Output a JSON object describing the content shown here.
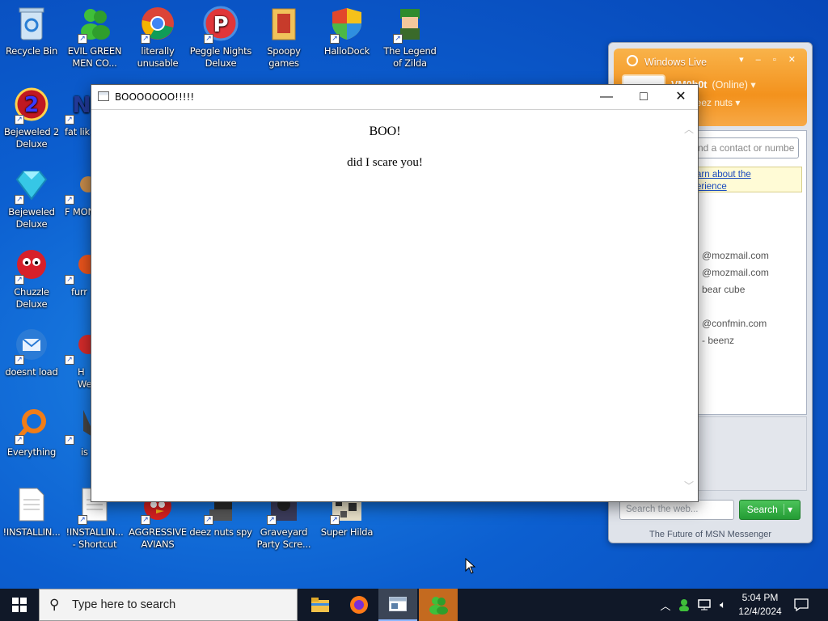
{
  "desktop": {
    "icons": [
      {
        "label": "Recycle Bin",
        "icon": "recycle-bin-icon"
      },
      {
        "label": "EVIL GREEN MEN CO...",
        "icon": "green-men-icon"
      },
      {
        "label": "literally unusable",
        "icon": "chrome-icon"
      },
      {
        "label": "Peggle Nights Deluxe",
        "icon": "peggle-icon"
      },
      {
        "label": "Spoopy games",
        "icon": "folder-icon"
      },
      {
        "label": "HalloDock",
        "icon": "shield-icon"
      },
      {
        "label": "The Legend of Zilda",
        "icon": "zilda-icon"
      },
      {
        "label": "Bejeweled 2 Deluxe",
        "icon": "bejeweled2-icon"
      },
      {
        "label": "fat lik",
        "icon": "fat-lik-icon"
      },
      {
        "label": "Bejeweled Deluxe",
        "icon": "diamond-icon"
      },
      {
        "label": "F MON",
        "icon": "mon-icon"
      },
      {
        "label": "Chuzzle Deluxe",
        "icon": "chuzzle-icon"
      },
      {
        "label": "furr",
        "icon": "furr-icon"
      },
      {
        "label": "doesnt load",
        "icon": "thunderbird-icon"
      },
      {
        "label": "H We",
        "icon": "hwe-icon"
      },
      {
        "label": "Everything",
        "icon": "search-icon"
      },
      {
        "label": "is",
        "icon": "is-icon"
      },
      {
        "label": "!INSTALLIN...",
        "icon": "document-icon"
      },
      {
        "label": "!INSTALLIN... - Shortcut",
        "icon": "document-icon"
      },
      {
        "label": "AGGRESSIVE AVIANS",
        "icon": "angry-bird-icon"
      },
      {
        "label": "deez nuts spy",
        "icon": "spy-icon"
      },
      {
        "label": "Graveyard Party Scre...",
        "icon": "graveyard-icon"
      },
      {
        "label": "Super Hilda",
        "icon": "hilda-icon"
      }
    ]
  },
  "window": {
    "title": "BOOOOOOO!!!!!",
    "heading": "BOO!",
    "message": "did I scare you!",
    "minimize_glyph": "—",
    "maximize_glyph": "□",
    "close_glyph": "✕"
  },
  "msn": {
    "title": "Windows Live",
    "name": "VM0b0t",
    "status": "(Online) ▾",
    "personal_message": "rate deez nuts ▾",
    "search_placeholder": "nd a contact or numbe",
    "promo_line1": "arn about the",
    "promo_line2": "erience",
    "contacts": [
      "@mozmail.com",
      "@mozmail.com",
      "bear cube",
      "@confmin.com",
      "- beenz"
    ],
    "web_search_placeholder": "Search the web...",
    "search_button": "Search",
    "footer": "The Future of MSN Messenger"
  },
  "taskbar": {
    "search_placeholder": "Type here to search",
    "time": "5:04 PM",
    "date": "12/4/2024"
  },
  "colors": {
    "desktop_blue": "#0c5fd0",
    "msn_orange": "#f3921d",
    "search_green": "#239c34",
    "taskbar": "#101828"
  }
}
